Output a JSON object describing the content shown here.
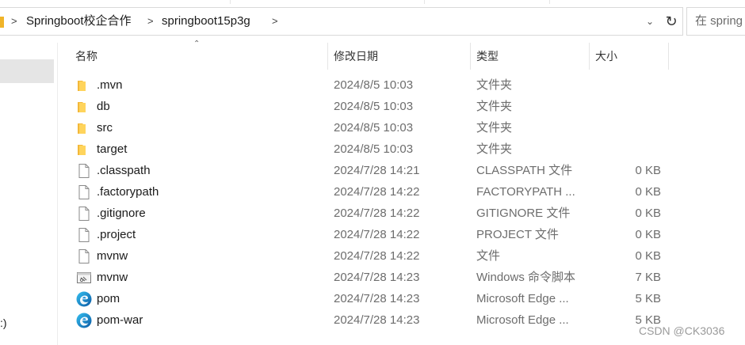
{
  "breadcrumb": {
    "items": [
      "Springboot校企合作",
      "springboot15p3g"
    ],
    "separator": ">"
  },
  "search": {
    "placeholder": "在 spring"
  },
  "columns": {
    "name": "名称",
    "modified": "修改日期",
    "type": "类型",
    "size": "大小"
  },
  "navpane": {
    "drive_label": ":)"
  },
  "files": [
    {
      "name": ".mvn",
      "modified": "2024/8/5 10:03",
      "type": "文件夹",
      "size": "",
      "icon": "folder-icon"
    },
    {
      "name": "db",
      "modified": "2024/8/5 10:03",
      "type": "文件夹",
      "size": "",
      "icon": "folder-icon"
    },
    {
      "name": "src",
      "modified": "2024/8/5 10:03",
      "type": "文件夹",
      "size": "",
      "icon": "folder-icon"
    },
    {
      "name": "target",
      "modified": "2024/8/5 10:03",
      "type": "文件夹",
      "size": "",
      "icon": "folder-icon"
    },
    {
      "name": ".classpath",
      "modified": "2024/7/28 14:21",
      "type": "CLASSPATH 文件",
      "size": "0 KB",
      "icon": "file-icon"
    },
    {
      "name": ".factorypath",
      "modified": "2024/7/28 14:22",
      "type": "FACTORYPATH ...",
      "size": "0 KB",
      "icon": "file-icon"
    },
    {
      "name": ".gitignore",
      "modified": "2024/7/28 14:22",
      "type": "GITIGNORE 文件",
      "size": "0 KB",
      "icon": "file-icon"
    },
    {
      "name": ".project",
      "modified": "2024/7/28 14:22",
      "type": "PROJECT 文件",
      "size": "0 KB",
      "icon": "file-icon"
    },
    {
      "name": "mvnw",
      "modified": "2024/7/28 14:22",
      "type": "文件",
      "size": "0 KB",
      "icon": "file-icon"
    },
    {
      "name": "mvnw",
      "modified": "2024/7/28 14:23",
      "type": "Windows 命令脚本",
      "size": "7 KB",
      "icon": "script-icon"
    },
    {
      "name": "pom",
      "modified": "2024/7/28 14:23",
      "type": "Microsoft Edge ...",
      "size": "5 KB",
      "icon": "edge-icon"
    },
    {
      "name": "pom-war",
      "modified": "2024/7/28 14:23",
      "type": "Microsoft Edge ...",
      "size": "5 KB",
      "icon": "edge-icon"
    }
  ],
  "watermark": "CSDN @CK3036"
}
